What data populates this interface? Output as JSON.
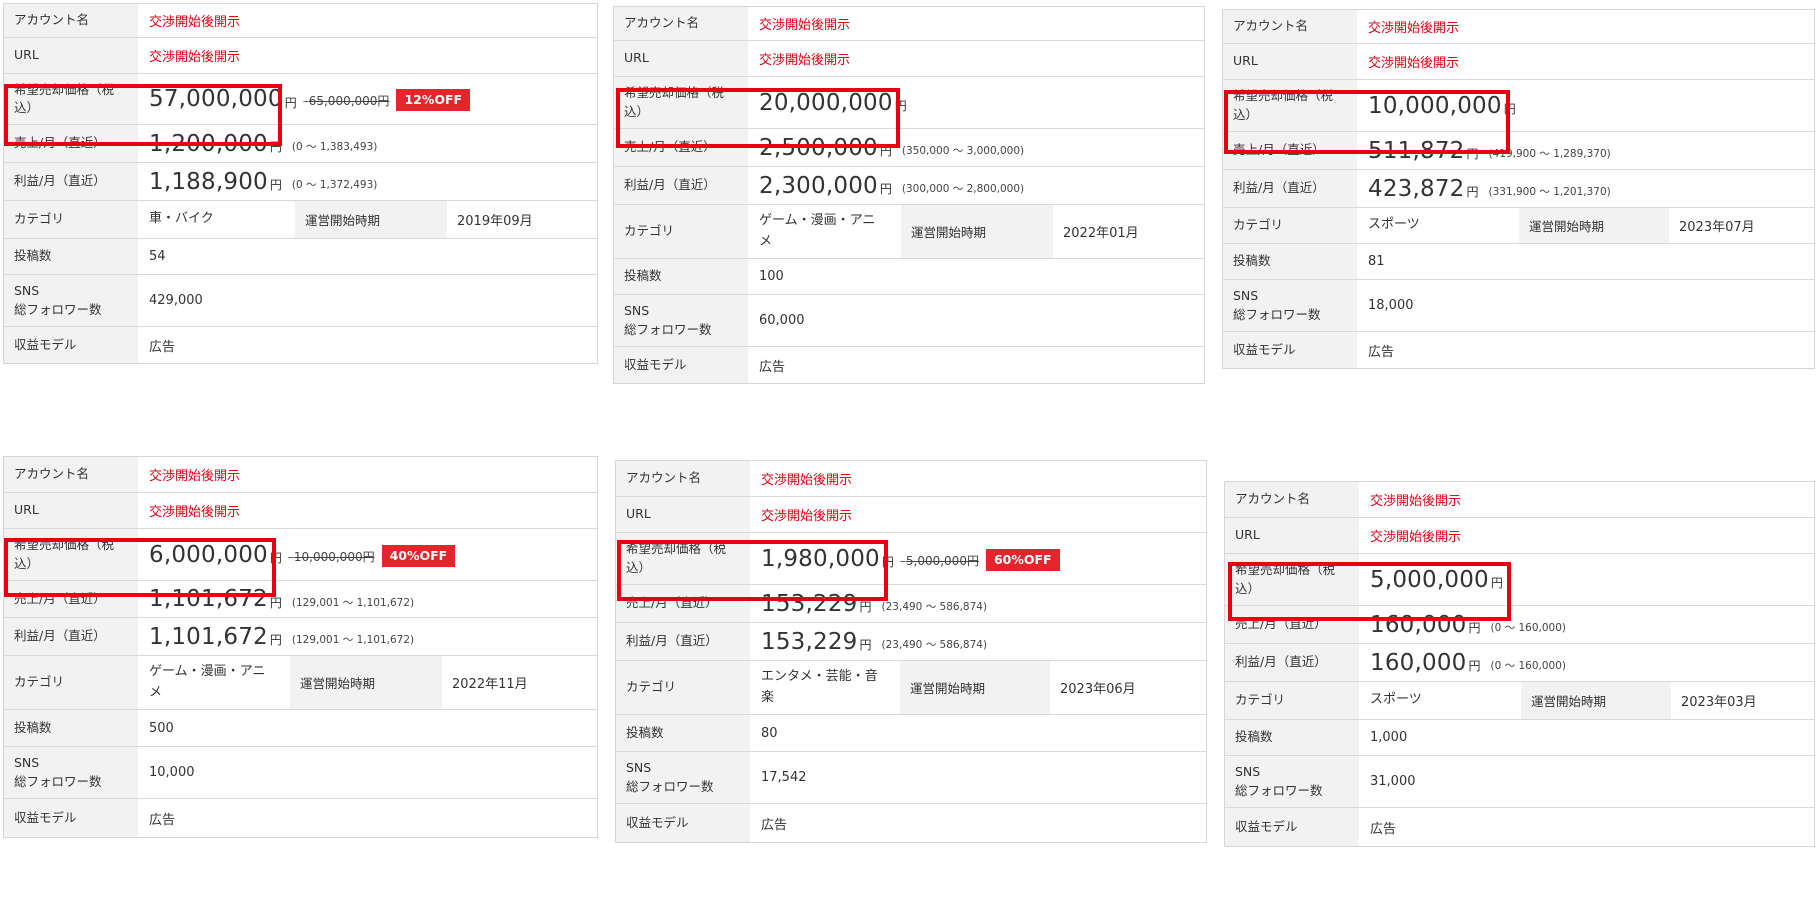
{
  "labels": {
    "account_name": "アカウント名",
    "url": "URL",
    "price": "希望売却価格（税\n込）",
    "sales": "売上/月（直近）",
    "profit": "利益/月（直近）",
    "category": "カテゴリ",
    "start": "運営開始時期",
    "posts": "投稿数",
    "sns": "SNS\n総フォロワー数",
    "revenue_model": "収益モデル",
    "yen": "円"
  },
  "colors": {
    "accent": "#e60012",
    "badge": "#e4262c",
    "label_bg": "#f2f2f2"
  },
  "cards": [
    {
      "account": "交渉開始後開示",
      "url": "交渉開始後開示",
      "price": "57,000,000",
      "original": "65,000,000円",
      "discount": "12%OFF",
      "sales": "1,200,000",
      "sales_range": "(0 ～ 1,383,493)",
      "profit": "1,188,900",
      "profit_range": "(0 ～ 1,372,493)",
      "category": "車・バイク",
      "start": "2019年09月",
      "posts": "54",
      "followers": "429,000",
      "model": "広告"
    },
    {
      "account": "交渉開始後開示",
      "url": "交渉開始後開示",
      "price": "20,000,000",
      "original": "",
      "discount": "",
      "sales": "2,500,000",
      "sales_range": "(350,000 ～ 3,000,000)",
      "profit": "2,300,000",
      "profit_range": "(300,000 ～ 2,800,000)",
      "category": "ゲーム・漫画・アニ\nメ",
      "start": "2022年01月",
      "posts": "100",
      "followers": "60,000",
      "model": "広告"
    },
    {
      "account": "交渉開始後開示",
      "url": "交渉開始後開示",
      "price": "10,000,000",
      "original": "",
      "discount": "",
      "sales": "511,872",
      "sales_range": "(419,900 ～ 1,289,370)",
      "profit": "423,872",
      "profit_range": "(331,900 ～ 1,201,370)",
      "category": "スポーツ",
      "start": "2023年07月",
      "posts": "81",
      "followers": "18,000",
      "model": "広告"
    },
    {
      "account": "交渉開始後開示",
      "url": "交渉開始後開示",
      "price": "6,000,000",
      "original": "10,000,000円",
      "discount": "40%OFF",
      "sales": "1,101,672",
      "sales_range": "(129,001 ～ 1,101,672)",
      "profit": "1,101,672",
      "profit_range": "(129,001 ～ 1,101,672)",
      "category": "ゲーム・漫画・アニ\nメ",
      "start": "2022年11月",
      "posts": "500",
      "followers": "10,000",
      "model": "広告"
    },
    {
      "account": "交渉開始後開示",
      "url": "交渉開始後開示",
      "price": "1,980,000",
      "original": "5,000,000円",
      "discount": "60%OFF",
      "sales": "153,229",
      "sales_range": "(23,490 ～ 586,874)",
      "profit": "153,229",
      "profit_range": "(23,490 ～ 586,874)",
      "category": "エンタメ・芸能・音\n楽",
      "start": "2023年06月",
      "posts": "80",
      "followers": "17,542",
      "model": "広告"
    },
    {
      "account": "交渉開始後開示",
      "url": "交渉開始後開示",
      "price": "5,000,000",
      "original": "",
      "discount": "",
      "sales": "160,000",
      "sales_range": "(0 ～ 160,000)",
      "profit": "160,000",
      "profit_range": "(0 ～ 160,000)",
      "category": "スポーツ",
      "start": "2023年03月",
      "posts": "1,000",
      "followers": "31,000",
      "model": "広告"
    }
  ]
}
